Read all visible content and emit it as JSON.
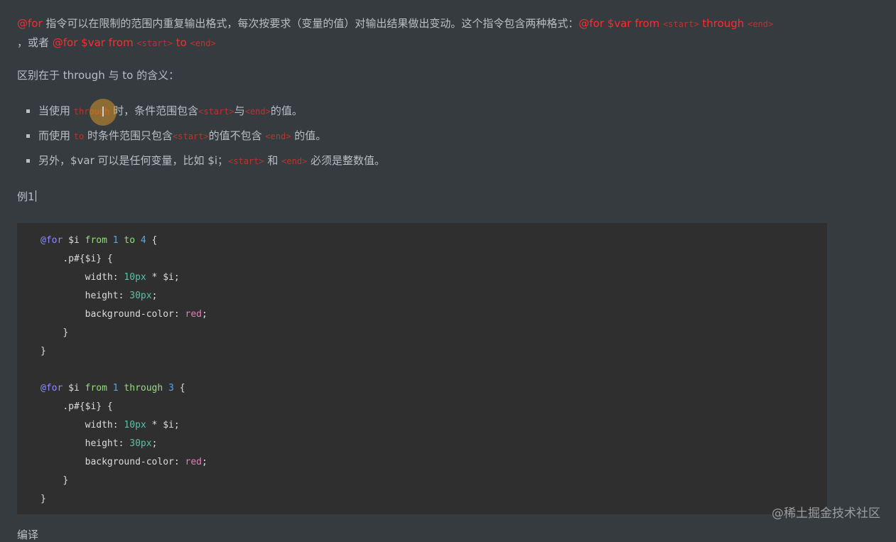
{
  "intro": {
    "for_kw": "@for",
    "text_a": " 指令可以在限制的范围内重复输出格式，每次按要求（变量的值）对输出结果做出变动。这个指令包含两种格式：",
    "syntax1_a": "@for $var from ",
    "start": "<start>",
    "syntax1_b": " through ",
    "end": "<end>",
    "text_b": "，或者 ",
    "syntax2_a": "@for $var from ",
    "syntax2_b": " to "
  },
  "difference": "区别在于 through 与 to 的含义：",
  "bullets": [
    {
      "a": "当使用 ",
      "code": "through",
      "b": " 时，条件范围包含",
      "start": "<start>",
      "c": "与",
      "end": "<end>",
      "d": "的值。"
    },
    {
      "a": "而使用 ",
      "code": "to",
      "b": " 时条件范围只包含",
      "start": "<start>",
      "c": "的值不包含 ",
      "end": "<end>",
      "d": " 的值。"
    },
    {
      "a": "另外，$var 可以是任何变量，比如 $i；",
      "start": "<start>",
      "c": " 和 ",
      "end": "<end>",
      "d": " 必须是整数值。"
    }
  ],
  "example_label": "例1",
  "code": {
    "for_kw": "@for",
    "var": "$i",
    "from_kw": "from",
    "to_kw": "to",
    "through_kw": "through",
    "n1": "1",
    "n4": "4",
    "n3": "3",
    "selector": ".p#{$i} {",
    "width_prop": "width: ",
    "width_val": "10px",
    "width_rest": " * $i;",
    "height_prop": "height: ",
    "height_val": "30px",
    "bg_prop": "background-color: ",
    "bg_val": "red",
    "semicolon": ";",
    "open_brace": " {",
    "close_brace": "}"
  },
  "watermark": "@稀土掘金技术社区",
  "bottom_partial": "编译"
}
